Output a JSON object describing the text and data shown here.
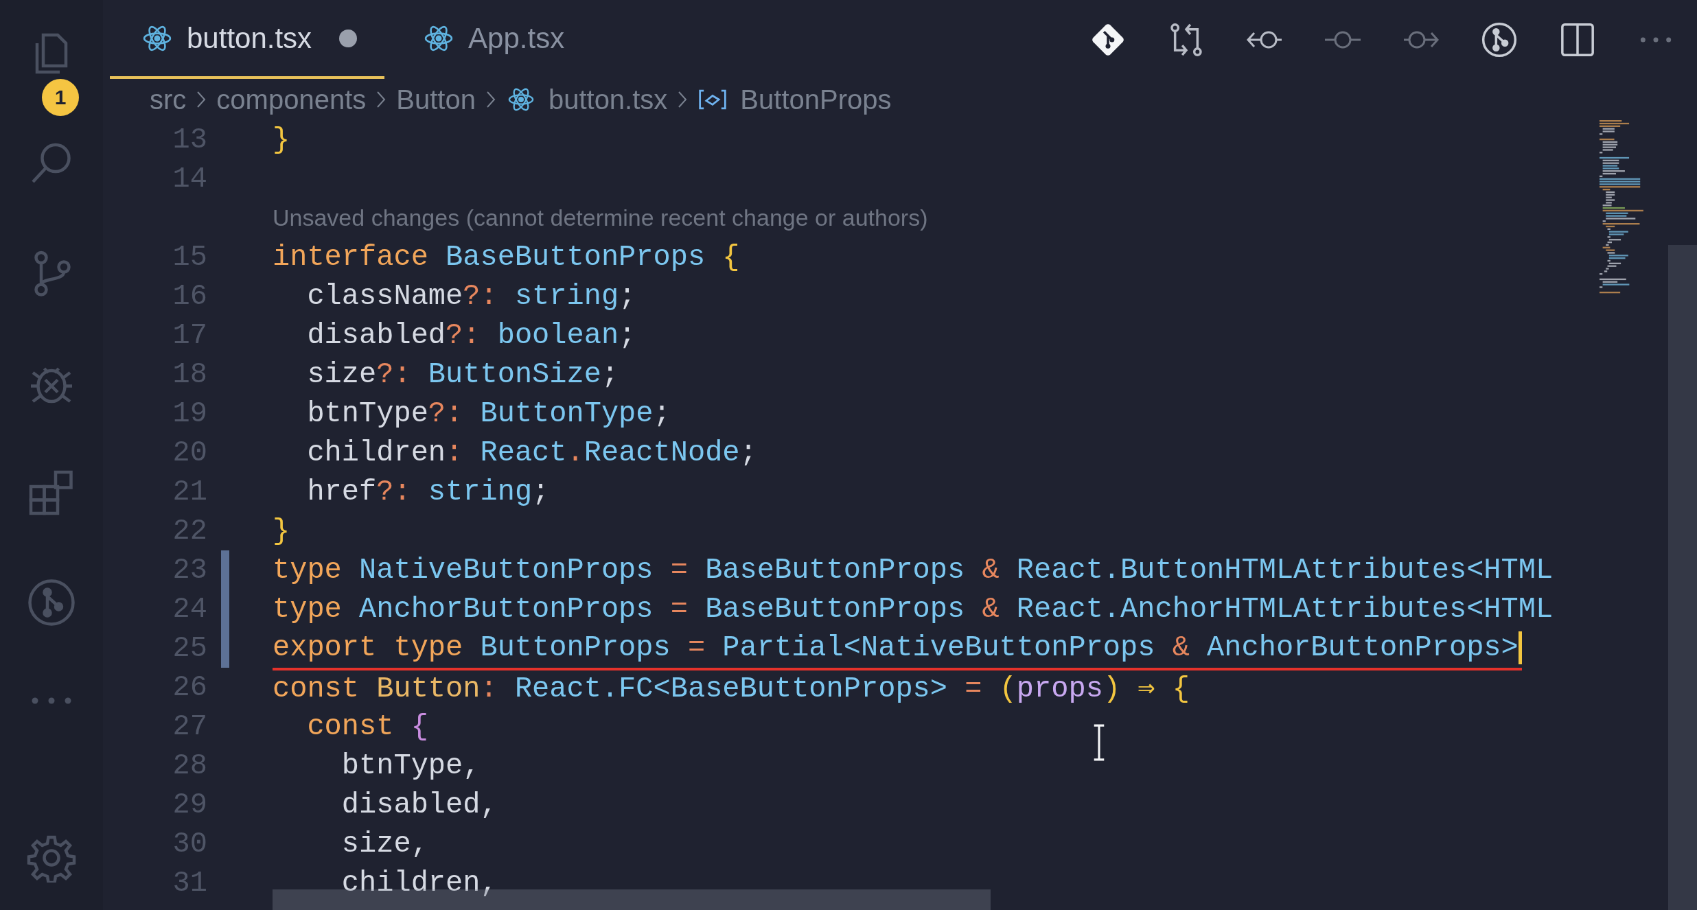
{
  "activity_bar": {
    "badge": "1"
  },
  "tabs": [
    {
      "label": "button.tsx",
      "selected": true,
      "dirty": true
    },
    {
      "label": "App.tsx",
      "selected": false,
      "dirty": false
    }
  ],
  "breadcrumbs": [
    {
      "label": "src",
      "kind": "folder"
    },
    {
      "label": "components",
      "kind": "folder"
    },
    {
      "label": "Button",
      "kind": "folder"
    },
    {
      "label": "button.tsx",
      "kind": "file"
    },
    {
      "label": "ButtonProps",
      "kind": "symbol"
    }
  ],
  "editor": {
    "lines": [
      {
        "kind": "code",
        "number": "13",
        "modified": false,
        "tokens": [
          {
            "text": "}",
            "kind": "brace"
          }
        ]
      },
      {
        "kind": "code",
        "number": "14",
        "modified": false
      },
      {
        "kind": "codelens",
        "text": "Unsaved changes (cannot determine recent change or authors)"
      },
      {
        "kind": "code",
        "number": "15",
        "modified": false,
        "tokens": [
          {
            "text": "interface",
            "kind": "keyword"
          },
          {
            "text": " BaseButtonProps ",
            "kind": "type"
          },
          {
            "text": "{",
            "kind": "brace"
          }
        ]
      },
      {
        "kind": "code",
        "number": "16",
        "modified": false,
        "tokens": [
          {
            "text": "  className",
            "kind": "plain"
          },
          {
            "text": "?:",
            "kind": "operator"
          },
          {
            "text": " string",
            "kind": "type"
          },
          {
            "text": ";",
            "kind": "plain"
          }
        ]
      },
      {
        "kind": "code",
        "number": "17",
        "modified": false,
        "tokens": [
          {
            "text": "  disabled",
            "kind": "plain"
          },
          {
            "text": "?:",
            "kind": "operator"
          },
          {
            "text": " boolean",
            "kind": "type"
          },
          {
            "text": ";",
            "kind": "plain"
          }
        ]
      },
      {
        "kind": "code",
        "number": "18",
        "modified": false,
        "tokens": [
          {
            "text": "  size",
            "kind": "plain"
          },
          {
            "text": "?:",
            "kind": "operator"
          },
          {
            "text": " ButtonSize",
            "kind": "type"
          },
          {
            "text": ";",
            "kind": "plain"
          }
        ]
      },
      {
        "kind": "code",
        "number": "19",
        "modified": false,
        "tokens": [
          {
            "text": "  btnType",
            "kind": "plain"
          },
          {
            "text": "?:",
            "kind": "operator"
          },
          {
            "text": " ButtonType",
            "kind": "type"
          },
          {
            "text": ";",
            "kind": "plain"
          }
        ]
      },
      {
        "kind": "code",
        "number": "20",
        "modified": false,
        "tokens": [
          {
            "text": "  children",
            "kind": "plain"
          },
          {
            "text": ":",
            "kind": "operator"
          },
          {
            "text": " React",
            "kind": "type"
          },
          {
            "text": ".",
            "kind": "operator"
          },
          {
            "text": "ReactNode",
            "kind": "type"
          },
          {
            "text": ";",
            "kind": "plain"
          }
        ]
      },
      {
        "kind": "code",
        "number": "21",
        "modified": false,
        "tokens": [
          {
            "text": "  href",
            "kind": "plain"
          },
          {
            "text": "?:",
            "kind": "operator"
          },
          {
            "text": " string",
            "kind": "type"
          },
          {
            "text": ";",
            "kind": "plain"
          }
        ]
      },
      {
        "kind": "code",
        "number": "22",
        "modified": false,
        "tokens": [
          {
            "text": "}",
            "kind": "brace"
          }
        ]
      },
      {
        "kind": "code",
        "number": "23",
        "modified": true,
        "tokens": [
          {
            "text": "type",
            "kind": "keyword"
          },
          {
            "text": " NativeButtonProps ",
            "kind": "type"
          },
          {
            "text": "=",
            "kind": "operator"
          },
          {
            "text": " BaseButtonProps ",
            "kind": "type"
          },
          {
            "text": "&",
            "kind": "operator"
          },
          {
            "text": " React.ButtonHTMLAttributes<HTML",
            "kind": "type"
          }
        ]
      },
      {
        "kind": "code",
        "number": "24",
        "modified": true,
        "tokens": [
          {
            "text": "type",
            "kind": "keyword"
          },
          {
            "text": " AnchorButtonProps ",
            "kind": "type"
          },
          {
            "text": "=",
            "kind": "operator"
          },
          {
            "text": " BaseButtonProps ",
            "kind": "type"
          },
          {
            "text": "&",
            "kind": "operator"
          },
          {
            "text": " React.AnchorHTMLAttributes<HTML",
            "kind": "type"
          }
        ]
      },
      {
        "kind": "code",
        "number": "25",
        "modified": true,
        "underlined": true,
        "cursor": true,
        "tokens": [
          {
            "text": "export type",
            "kind": "keyword"
          },
          {
            "text": " ButtonProps ",
            "kind": "type"
          },
          {
            "text": "=",
            "kind": "operator"
          },
          {
            "text": " Partial<NativeButtonProps ",
            "kind": "type"
          },
          {
            "text": "&",
            "kind": "operator"
          },
          {
            "text": " AnchorButtonProps>",
            "kind": "type"
          }
        ]
      },
      {
        "kind": "code",
        "number": "26",
        "modified": false,
        "tokens": [
          {
            "text": "const",
            "kind": "keyword"
          },
          {
            "text": " Button",
            "kind": "name"
          },
          {
            "text": ":",
            "kind": "operator"
          },
          {
            "text": " React.FC<BaseButtonProps> ",
            "kind": "type"
          },
          {
            "text": "=",
            "kind": "operator"
          },
          {
            "text": " (",
            "kind": "brace"
          },
          {
            "text": "props",
            "kind": "param"
          },
          {
            "text": ") ⇒ {",
            "kind": "brace"
          }
        ]
      },
      {
        "kind": "code",
        "number": "27",
        "modified": false,
        "tokens": [
          {
            "text": "  const",
            "kind": "keyword"
          },
          {
            "text": " {",
            "kind": "brace2"
          }
        ]
      },
      {
        "kind": "code",
        "number": "28",
        "modified": false,
        "tokens": [
          {
            "text": "    btnType,",
            "kind": "plain"
          }
        ]
      },
      {
        "kind": "code",
        "number": "29",
        "modified": false,
        "tokens": [
          {
            "text": "    disabled,",
            "kind": "plain"
          }
        ]
      },
      {
        "kind": "code",
        "number": "30",
        "modified": false,
        "tokens": [
          {
            "text": "    size,",
            "kind": "plain"
          }
        ]
      },
      {
        "kind": "code",
        "number": "31",
        "modified": false,
        "tokens": [
          {
            "text": "    children,",
            "kind": "plain"
          }
        ]
      }
    ]
  }
}
